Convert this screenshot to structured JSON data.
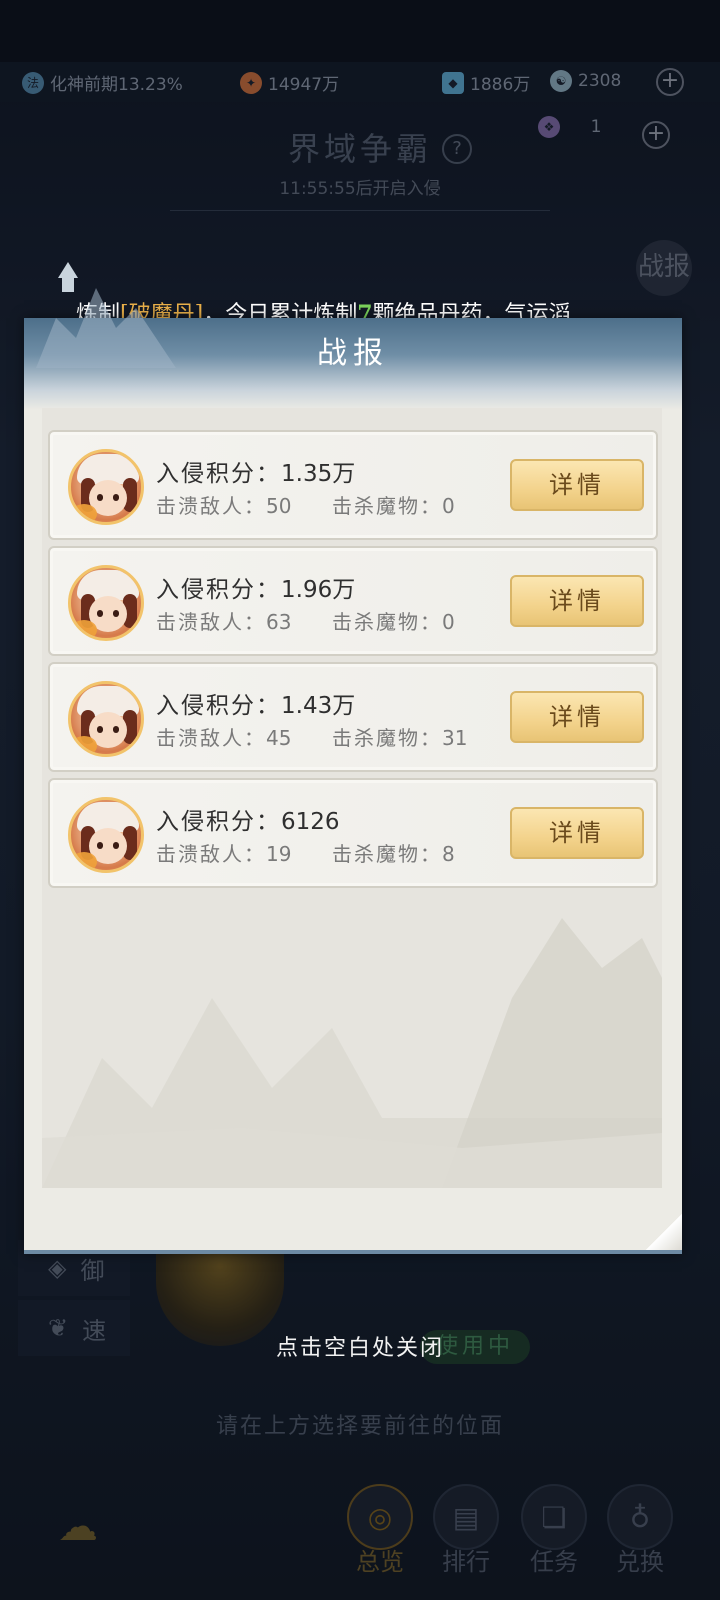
{
  "status": {
    "realm": "化神前期13.23%",
    "coins": "14947万",
    "crystals": "1886万",
    "spirit": "2308",
    "tickets": "1"
  },
  "header": {
    "title": "界域争霸",
    "countdown": "11:55:55后开启入侵"
  },
  "side_battle_label": "战报",
  "news": {
    "prefix": "炼制",
    "highlight": "[破魔丹]",
    "middle": "，今日累计炼制",
    "number": "7",
    "suffix": "颗绝品丹药，气运滔"
  },
  "modal": {
    "title": "战报",
    "records": [
      {
        "score_label": "入侵积分：",
        "score": "1.35万",
        "routed_label": "击溃敌人：",
        "routed": "50",
        "killed_label": "击杀魔物：",
        "killed": "0",
        "button": "详情"
      },
      {
        "score_label": "入侵积分：",
        "score": "1.96万",
        "routed_label": "击溃敌人：",
        "routed": "63",
        "killed_label": "击杀魔物：",
        "killed": "0",
        "button": "详情"
      },
      {
        "score_label": "入侵积分：",
        "score": "1.43万",
        "routed_label": "击溃敌人：",
        "routed": "45",
        "killed_label": "击杀魔物：",
        "killed": "31",
        "button": "详情"
      },
      {
        "score_label": "入侵积分：",
        "score": "6126",
        "routed_label": "击溃敌人：",
        "routed": "19",
        "killed_label": "击杀魔物：",
        "killed": "8",
        "button": "详情"
      }
    ]
  },
  "side_buttons": [
    {
      "label": "御"
    },
    {
      "label": "速"
    }
  ],
  "in_use_label": "使用中",
  "close_hint": "点击空白处关闭",
  "select_hint": "请在上方选择要前往的位面",
  "nav": [
    {
      "label": "总览",
      "icon": "swirl-icon"
    },
    {
      "label": "排行",
      "icon": "banner-icon"
    },
    {
      "label": "任务",
      "icon": "scroll-icon"
    },
    {
      "label": "兑换",
      "icon": "gourd-icon"
    }
  ],
  "colors": {
    "accent_gold": "#e9b04a",
    "highlight_green": "#7bd35b",
    "button_gold": "#f3d38c",
    "modal_paper": "#ecebe5"
  }
}
